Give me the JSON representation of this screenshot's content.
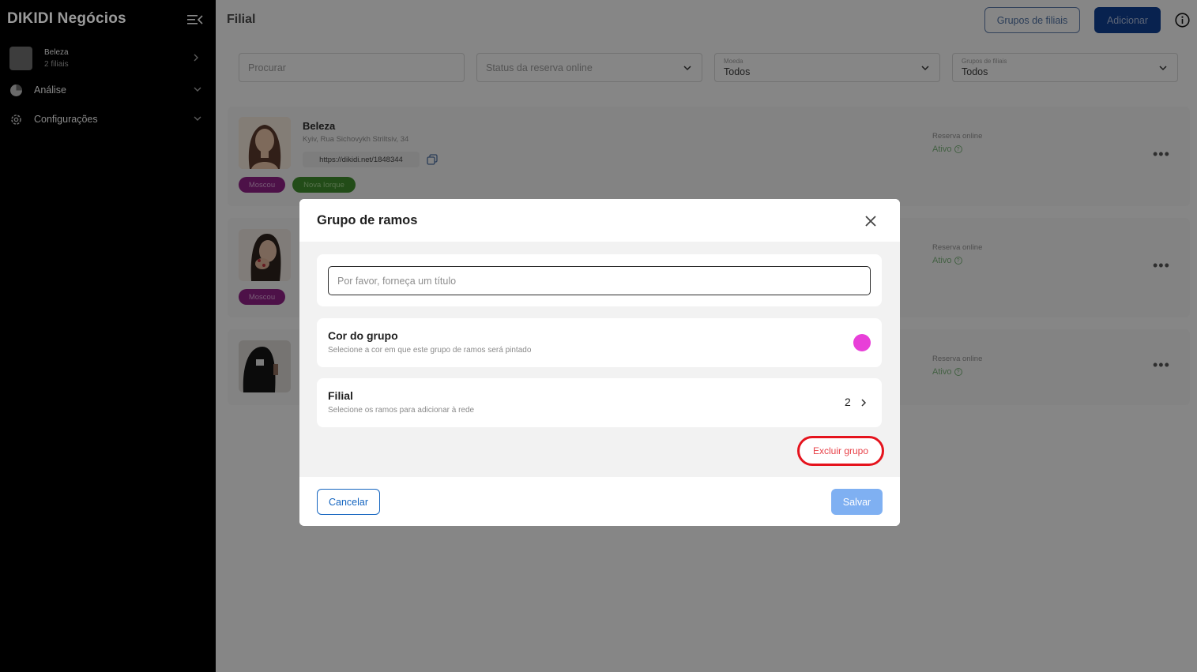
{
  "sidebar": {
    "brand": "DIKIDI Negócios",
    "company": {
      "name": "Beleza",
      "subtitle": "2 filiais"
    },
    "items": [
      {
        "label": "Análise",
        "icon": "pie-chart-icon"
      },
      {
        "label": "Configurações",
        "icon": "gear-icon"
      }
    ]
  },
  "header": {
    "title": "Filial",
    "groups_button": "Grupos de filiais",
    "add_button": "Adicionar"
  },
  "filters": {
    "search_placeholder": "Procurar",
    "status_placeholder": "Status da reserva online",
    "currency": {
      "label": "Moeda",
      "value": "Todos"
    },
    "groups": {
      "label": "Grupos de filiais",
      "value": "Todos"
    }
  },
  "branches": [
    {
      "name": "Beleza",
      "address": "Kyiv, Rua Sichovykh Striltsiv, 34",
      "link": "https://dikidi.net/1848344",
      "tags": [
        "Moscou",
        "Nova Iorque"
      ],
      "reservation_label": "Reserva online",
      "reservation_status": "Ativo"
    },
    {
      "tags": [
        "Moscou"
      ],
      "reservation_label": "Reserva online",
      "reservation_status": "Ativo"
    },
    {
      "reservation_label": "Reserva online",
      "reservation_status": "Ativo"
    }
  ],
  "modal": {
    "title": "Grupo de ramos",
    "title_placeholder": "Por favor, forneça um título",
    "color_section": {
      "title": "Cor do grupo",
      "subtitle": "Selecione a cor em que este grupo de ramos será pintado",
      "color": "#e83fd8"
    },
    "branch_section": {
      "title": "Filial",
      "subtitle": "Selecione os ramos para adicionar à rede",
      "count": "2"
    },
    "delete_label": "Excluir grupo",
    "cancel_label": "Cancelar",
    "save_label": "Salvar"
  },
  "colors": {
    "primary": "#1565c0",
    "danger": "#e5131d",
    "tag_moscou": "#8d1f84",
    "tag_ny": "#3e8a2c"
  }
}
